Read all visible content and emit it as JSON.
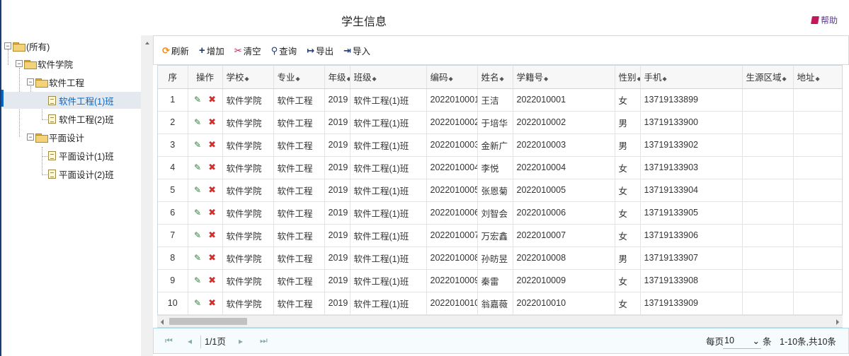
{
  "header": {
    "title": "学生信息",
    "help_label": "帮助"
  },
  "tree": {
    "root": "(所有)",
    "college": "软件学院",
    "major1": "软件工程",
    "class1": "软件工程(1)班",
    "class2": "软件工程(2)班",
    "major2": "平面设计",
    "class3": "平面设计(1)班",
    "class4": "平面设计(2)班"
  },
  "toolbar": {
    "refresh": "刷新",
    "add": "增加",
    "clear": "清空",
    "query": "查询",
    "export": "导出",
    "import": "导入"
  },
  "grid": {
    "columns": {
      "seq": "序",
      "ops": "操作",
      "school": "学校",
      "major": "专业",
      "grade": "年级",
      "class": "班级",
      "code": "编码",
      "name": "姓名",
      "student_no": "学籍号",
      "gender": "性别",
      "phone": "手机",
      "region": "生源区域",
      "address": "地址"
    },
    "rows": [
      {
        "seq": "1",
        "school": "软件学院",
        "major": "软件工程",
        "grade": "2019",
        "class": "软件工程(1)班",
        "code": "2022010001",
        "name": "王洁",
        "student_no": "2022010001",
        "gender": "女",
        "phone": "13719133899"
      },
      {
        "seq": "2",
        "school": "软件学院",
        "major": "软件工程",
        "grade": "2019",
        "class": "软件工程(1)班",
        "code": "2022010002",
        "name": "于培华",
        "student_no": "2022010002",
        "gender": "男",
        "phone": "13719133900"
      },
      {
        "seq": "3",
        "school": "软件学院",
        "major": "软件工程",
        "grade": "2019",
        "class": "软件工程(1)班",
        "code": "2022010003",
        "name": "金新广",
        "student_no": "2022010003",
        "gender": "男",
        "phone": "13719133902"
      },
      {
        "seq": "4",
        "school": "软件学院",
        "major": "软件工程",
        "grade": "2019",
        "class": "软件工程(1)班",
        "code": "2022010004",
        "name": "李悦",
        "student_no": "2022010004",
        "gender": "女",
        "phone": "13719133903"
      },
      {
        "seq": "5",
        "school": "软件学院",
        "major": "软件工程",
        "grade": "2019",
        "class": "软件工程(1)班",
        "code": "2022010005",
        "name": "张恩菊",
        "student_no": "2022010005",
        "gender": "女",
        "phone": "13719133904"
      },
      {
        "seq": "6",
        "school": "软件学院",
        "major": "软件工程",
        "grade": "2019",
        "class": "软件工程(1)班",
        "code": "2022010006",
        "name": "刘智会",
        "student_no": "2022010006",
        "gender": "女",
        "phone": "13719133905"
      },
      {
        "seq": "7",
        "school": "软件学院",
        "major": "软件工程",
        "grade": "2019",
        "class": "软件工程(1)班",
        "code": "2022010007",
        "name": "万宏鑫",
        "student_no": "2022010007",
        "gender": "女",
        "phone": "13719133906"
      },
      {
        "seq": "8",
        "school": "软件学院",
        "major": "软件工程",
        "grade": "2019",
        "class": "软件工程(1)班",
        "code": "2022010008",
        "name": "孙昉昱",
        "student_no": "2022010008",
        "gender": "男",
        "phone": "13719133907"
      },
      {
        "seq": "9",
        "school": "软件学院",
        "major": "软件工程",
        "grade": "2019",
        "class": "软件工程(1)班",
        "code": "2022010009",
        "name": "秦雷",
        "student_no": "2022010009",
        "gender": "女",
        "phone": "13719133908"
      },
      {
        "seq": "10",
        "school": "软件学院",
        "major": "软件工程",
        "grade": "2019",
        "class": "软件工程(1)班",
        "code": "2022010010",
        "name": "翁嘉薇",
        "student_no": "2022010010",
        "gender": "女",
        "phone": "13719133909"
      }
    ]
  },
  "pager": {
    "page_info": "1/1页",
    "size_label": "每页",
    "size_value": "10",
    "size_unit": "条",
    "summary": "1-10条,共10条"
  },
  "colors": {
    "accent": "#0a66c2",
    "sidebar_edge": "#1c3d74",
    "refresh": "#ef8a1f",
    "delete": "#d32f2f",
    "edit": "#2e7d32"
  }
}
